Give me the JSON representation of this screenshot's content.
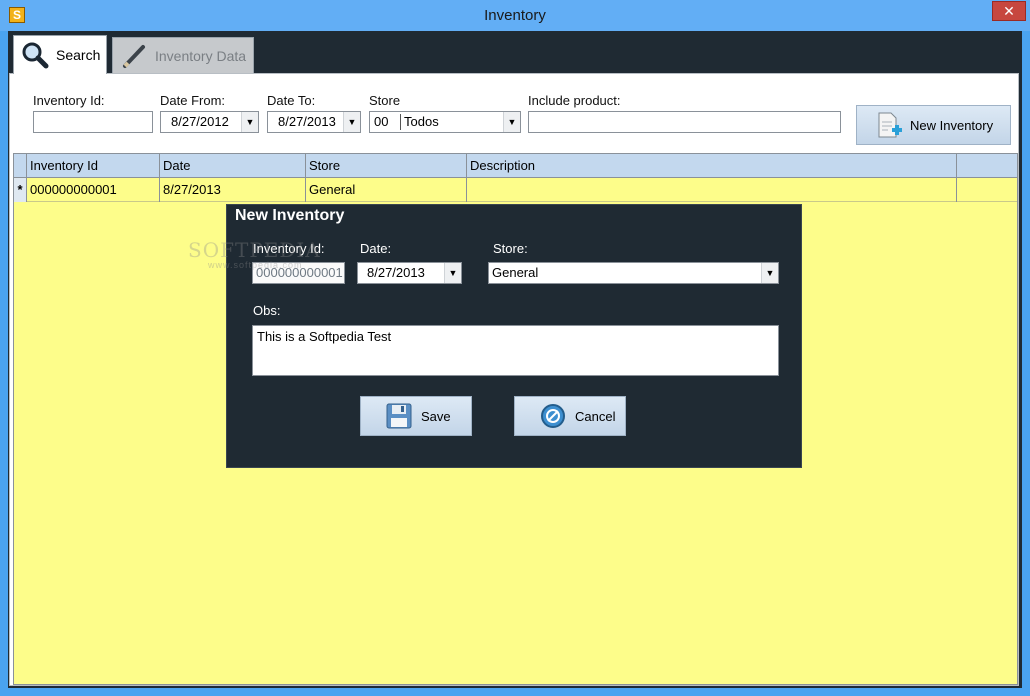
{
  "window": {
    "title": "Inventory",
    "app_icon_letter": "S",
    "close_glyph": "✕"
  },
  "tabs": [
    {
      "label": "Search",
      "icon": "magnifier-icon",
      "active": true
    },
    {
      "label": "Inventory Data",
      "icon": "pencil-icon",
      "active": false
    }
  ],
  "filters": {
    "inventory_id": {
      "label": "Inventory Id:",
      "value": ""
    },
    "date_from": {
      "label": "Date From:",
      "value": "8/27/2012"
    },
    "date_to": {
      "label": "Date To:",
      "value": "8/27/2013"
    },
    "store": {
      "label": "Store",
      "code": "00",
      "name": "Todos"
    },
    "include_product": {
      "label": "Include product:",
      "value": ""
    },
    "new_button_label": "New Inventory"
  },
  "grid": {
    "columns": [
      "Inventory Id",
      "Date",
      "Store",
      "Description"
    ],
    "rows": [
      {
        "marker": "*",
        "cells": [
          "000000000001",
          "8/27/2013",
          "General",
          ""
        ]
      }
    ],
    "background": "#fdfd8a"
  },
  "dialog": {
    "title": "New Inventory",
    "inventory_id_label": "Inventory Id:",
    "inventory_id_value": "000000000001",
    "date_label": "Date:",
    "date_value": "8/27/2013",
    "store_label": "Store:",
    "store_value": "General",
    "obs_label": "Obs:",
    "obs_value": "This is a Softpedia Test",
    "save_label": "Save",
    "cancel_label": "Cancel"
  },
  "watermark": {
    "main": "SOFTPEDIA",
    "sub": "www.softpedia.com"
  }
}
